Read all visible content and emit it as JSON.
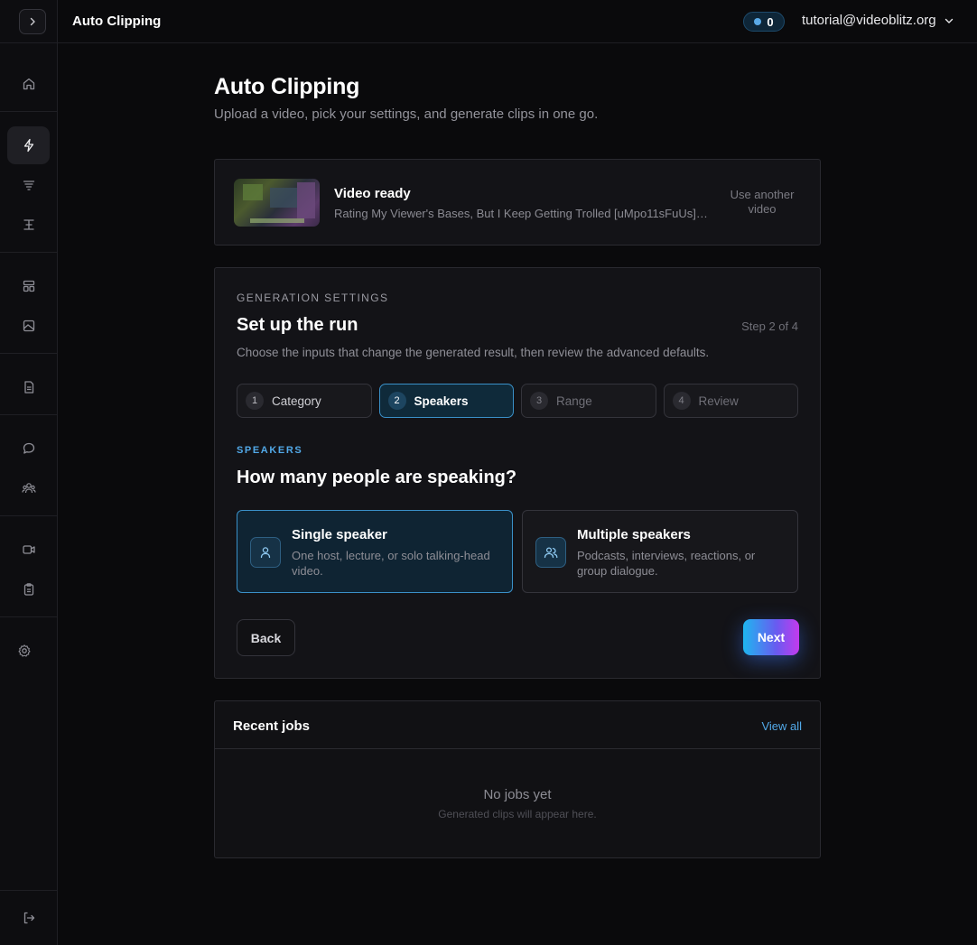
{
  "topbar": {
    "title": "Auto Clipping",
    "credits": "0",
    "account_email": "tutorial@videoblitz.org"
  },
  "sidebar": {
    "icons": [
      "home-icon",
      "lightning-icon",
      "captions-icon",
      "text-format-icon",
      "templates-icon",
      "image-edit-icon",
      "document-icon",
      "chat-icon",
      "team-icon",
      "video-icon",
      "clipboard-icon",
      "settings-icon",
      "logout-icon"
    ],
    "active": "lightning-icon"
  },
  "header": {
    "title": "Auto Clipping",
    "subtitle": "Upload a video, pick your settings, and generate clips in one go."
  },
  "video": {
    "status": "Video ready",
    "filename": "Rating My Viewer's Bases, But I Keep Getting Trolled [uMpo11sFuUs].te...",
    "change_label": "Use another video"
  },
  "settings": {
    "eyebrow": "GENERATION SETTINGS",
    "title": "Set up the run",
    "step_counter": "Step 2 of 4",
    "description": "Choose the inputs that change the generated result, then review the advanced defaults.",
    "steps": [
      {
        "num": "1",
        "label": "Category"
      },
      {
        "num": "2",
        "label": "Speakers"
      },
      {
        "num": "3",
        "label": "Range"
      },
      {
        "num": "4",
        "label": "Review"
      }
    ],
    "section_eyebrow": "SPEAKERS",
    "question": "How many people are speaking?",
    "options": [
      {
        "title": "Single speaker",
        "description": "One host, lecture, or solo talking-head video."
      },
      {
        "title": "Multiple speakers",
        "description": "Podcasts, interviews, reactions, or group dialogue."
      }
    ],
    "back_label": "Back",
    "next_label": "Next"
  },
  "jobs": {
    "title": "Recent jobs",
    "view_all": "View all",
    "empty_title": "No jobs yet",
    "empty_subtitle": "Generated clips will appear here."
  },
  "colors": {
    "accent": "#52a9e8",
    "selected_border": "#3a90c8",
    "background": "#0a0a0c"
  }
}
